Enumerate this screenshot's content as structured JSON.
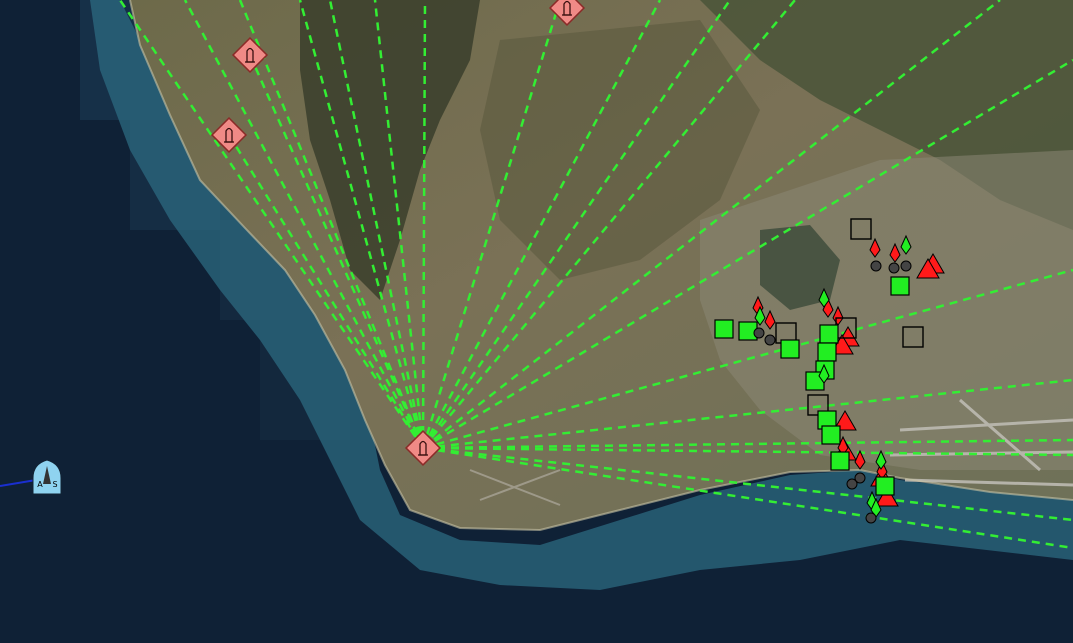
{
  "colors": {
    "ocean_deep": "#0e1f33",
    "ocean_mid": "#173552",
    "reef_shallow": "#2f6f86",
    "land_dry": "#7c7256",
    "land_green": "#4f5d3a",
    "mountain_dark": "#2f3527",
    "urban": "#8a8878",
    "runway": "#b8b6ad",
    "link_line": "#33ee33",
    "friendly_fill": "#22ee22",
    "hostile_fill": "#ff1a1a",
    "unknown_stroke": "#000000",
    "launch_site_fill": "#f08a86",
    "missile_marker_fill": "#8fd3f0",
    "track_line": "#1a2fd0"
  },
  "map": {
    "launch_sites": [
      {
        "icon": "launch-site-icon",
        "glyph": "rocket"
      },
      {
        "icon": "launch-site-icon",
        "glyph": "rocket"
      },
      {
        "icon": "launch-site-icon",
        "glyph": "rocket"
      },
      {
        "icon": "launch-site-icon",
        "glyph": "rocket"
      }
    ],
    "incoming_missile": {
      "icon": "missile-track-icon",
      "label_left": "A",
      "label_right": "S"
    },
    "unit_groups": [
      {
        "affiliation": "friendly",
        "shape": "square"
      },
      {
        "affiliation": "friendly",
        "shape": "diamond"
      },
      {
        "affiliation": "hostile",
        "shape": "triangle"
      },
      {
        "affiliation": "hostile",
        "shape": "diamond"
      },
      {
        "affiliation": "unknown",
        "shape": "open-square"
      },
      {
        "affiliation": "neutral",
        "shape": "circle"
      }
    ]
  }
}
